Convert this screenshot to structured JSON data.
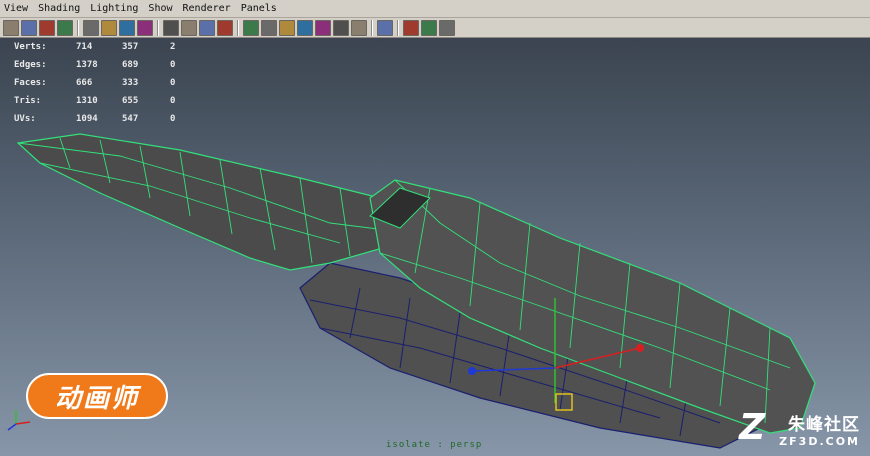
{
  "menu": [
    "View",
    "Shading",
    "Lighting",
    "Show",
    "Renderer",
    "Panels"
  ],
  "toolbar": {
    "icons": [
      "select-camera-icon",
      "lock-camera-icon",
      "bookmark-icon",
      "image-plane-icon",
      "separator",
      "wireframe-icon",
      "smooth-shade-icon",
      "textured-icon",
      "use-lights-icon",
      "separator",
      "film-gate-icon",
      "resolution-gate-icon",
      "gate-mask-icon",
      "field-chart-icon",
      "separator",
      "xray-icon",
      "shaded-wireframe-icon",
      "default-material-icon",
      "cube-icon",
      "light-bulb-icon",
      "backface-icon",
      "red-object-icon",
      "separator",
      "isolate-select-icon",
      "separator",
      "grid-icon",
      "camera-attributes-icon",
      "texture-tile-icon"
    ]
  },
  "hud": {
    "rows": [
      {
        "label": "Verts:",
        "v1": "714",
        "v2": "357",
        "v3": "2"
      },
      {
        "label": "Edges:",
        "v1": "1378",
        "v2": "689",
        "v3": "0"
      },
      {
        "label": "Faces:",
        "v1": "666",
        "v2": "333",
        "v3": "0"
      },
      {
        "label": "Tris:",
        "v1": "1310",
        "v2": "655",
        "v3": "0"
      },
      {
        "label": "UVs:",
        "v1": "1094",
        "v2": "547",
        "v3": "0"
      }
    ]
  },
  "viewport": {
    "camera_label": "isolate : persp",
    "colors": {
      "wire_selected": "#33e07a",
      "wire_unselected": "#1a1f6e",
      "mesh_fill": "#4a4a4a"
    }
  },
  "overlay": {
    "logo_text": "动画师",
    "watermark_line1": "朱峰社区",
    "watermark_line2": "ZF3D.COM"
  }
}
